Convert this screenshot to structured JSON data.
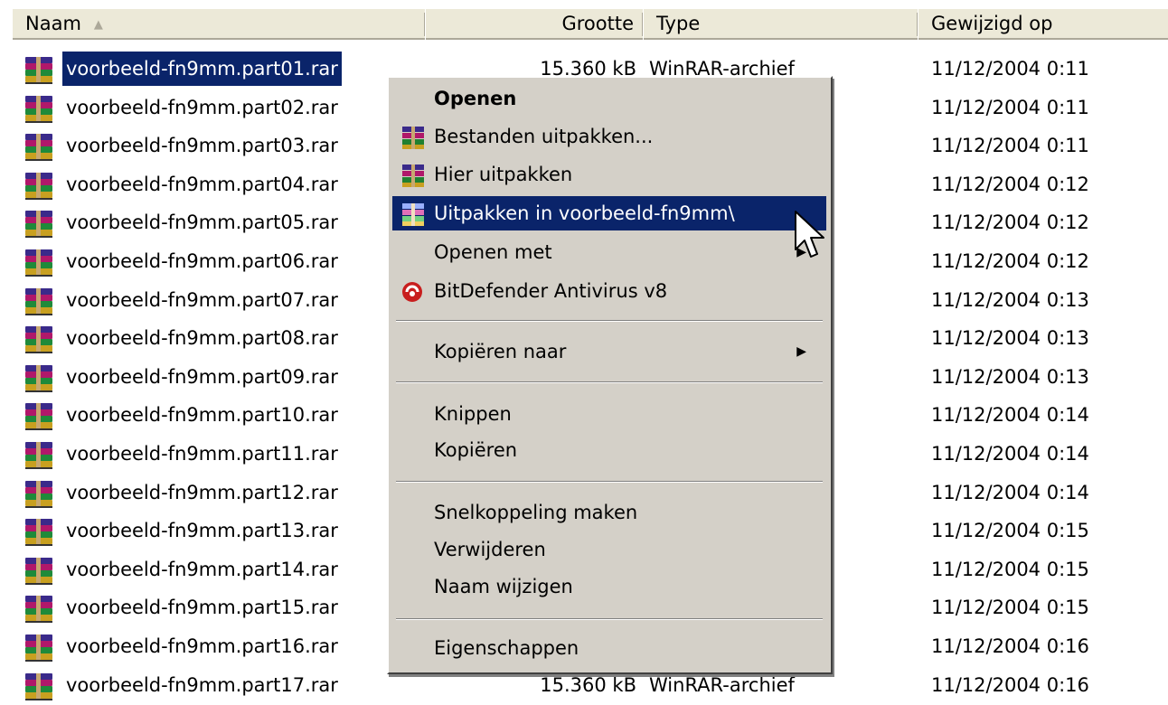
{
  "columns": {
    "name": "Naam",
    "size": "Grootte",
    "type": "Type",
    "modified": "Gewijzigd op"
  },
  "files": [
    {
      "name": "voorbeeld-fn9mm.part01.rar",
      "size": "15.360 kB",
      "type": "WinRAR-archief",
      "modified": "11/12/2004 0:11",
      "selected": true
    },
    {
      "name": "voorbeeld-fn9mm.part02.rar",
      "size": "",
      "type": "",
      "modified": "11/12/2004 0:11"
    },
    {
      "name": "voorbeeld-fn9mm.part03.rar",
      "size": "",
      "type": "",
      "modified": "11/12/2004 0:11"
    },
    {
      "name": "voorbeeld-fn9mm.part04.rar",
      "size": "",
      "type": "",
      "modified": "11/12/2004 0:12"
    },
    {
      "name": "voorbeeld-fn9mm.part05.rar",
      "size": "",
      "type": "",
      "modified": "11/12/2004 0:12"
    },
    {
      "name": "voorbeeld-fn9mm.part06.rar",
      "size": "",
      "type": "",
      "modified": "11/12/2004 0:12"
    },
    {
      "name": "voorbeeld-fn9mm.part07.rar",
      "size": "",
      "type": "",
      "modified": "11/12/2004 0:13"
    },
    {
      "name": "voorbeeld-fn9mm.part08.rar",
      "size": "",
      "type": "",
      "modified": "11/12/2004 0:13"
    },
    {
      "name": "voorbeeld-fn9mm.part09.rar",
      "size": "",
      "type": "",
      "modified": "11/12/2004 0:13"
    },
    {
      "name": "voorbeeld-fn9mm.part10.rar",
      "size": "",
      "type": "",
      "modified": "11/12/2004 0:14"
    },
    {
      "name": "voorbeeld-fn9mm.part11.rar",
      "size": "",
      "type": "",
      "modified": "11/12/2004 0:14"
    },
    {
      "name": "voorbeeld-fn9mm.part12.rar",
      "size": "",
      "type": "",
      "modified": "11/12/2004 0:14"
    },
    {
      "name": "voorbeeld-fn9mm.part13.rar",
      "size": "",
      "type": "",
      "modified": "11/12/2004 0:15"
    },
    {
      "name": "voorbeeld-fn9mm.part14.rar",
      "size": "",
      "type": "",
      "modified": "11/12/2004 0:15"
    },
    {
      "name": "voorbeeld-fn9mm.part15.rar",
      "size": "",
      "type": "",
      "modified": "11/12/2004 0:15"
    },
    {
      "name": "voorbeeld-fn9mm.part16.rar",
      "size": "",
      "type": "",
      "modified": "11/12/2004 0:16"
    },
    {
      "name": "voorbeeld-fn9mm.part17.rar",
      "size": "15.360 kB",
      "type": "WinRAR-archief",
      "modified": "11/12/2004 0:16"
    }
  ],
  "context_menu": {
    "open": "Openen",
    "extract_files": "Bestanden uitpakken...",
    "extract_here": "Hier uitpakken",
    "extract_to": "Uitpakken in voorbeeld-fn9mm\\",
    "open_with": "Openen met",
    "bitdefender": "BitDefender Antivirus v8",
    "copy_to": "Kopiëren naar",
    "cut": "Knippen",
    "copy": "Kopiëren",
    "create_shortcut": "Snelkoppeling maken",
    "delete": "Verwijderen",
    "rename": "Naam wijzigen",
    "properties": "Eigenschappen"
  },
  "icons": {
    "file": "winrar-archive-icon",
    "menu_winrar": "winrar-icon",
    "menu_bitdefender": "bitdefender-icon",
    "submenu": "submenu-arrow-icon",
    "sort": "sort-ascending-icon",
    "cursor": "mouse-pointer-icon"
  },
  "colors": {
    "selection": "#0a246a",
    "menu_bg": "#d4d0c8",
    "header_bg": "#ece9d8"
  }
}
